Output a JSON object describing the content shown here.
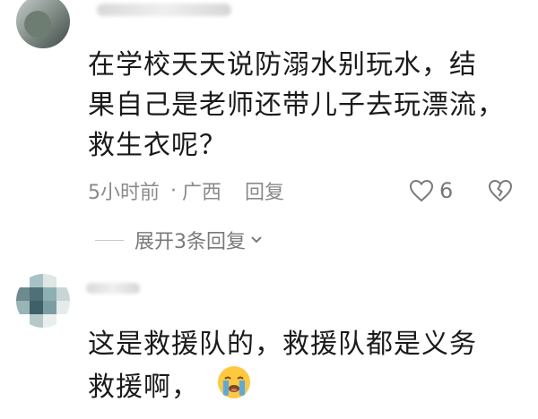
{
  "comments": [
    {
      "text_lines": [
        "在学校天天说防溺水别玩水，结",
        "果自己是老师还带儿子去玩漂流，",
        "救生衣呢？"
      ],
      "time": "5小时前",
      "separator": "·",
      "location": "广西",
      "reply_label": "回复",
      "like_count": "6"
    },
    {
      "text_lines": [
        "这是救援队的，救援队都是义务",
        "救援啊，"
      ],
      "emoji_icon": "crying-face-emoji"
    }
  ],
  "expand_replies": {
    "label": "展开3条回复"
  },
  "icons": {
    "like": "heart-outline-icon",
    "dislike": "broken-heart-outline-icon",
    "expand": "chevron-down-icon"
  },
  "colors": {
    "text": "#1a1a1a",
    "meta": "#8a8a8a",
    "emoji_face": "#ffc83d",
    "emoji_tear": "#5aa9e6"
  }
}
